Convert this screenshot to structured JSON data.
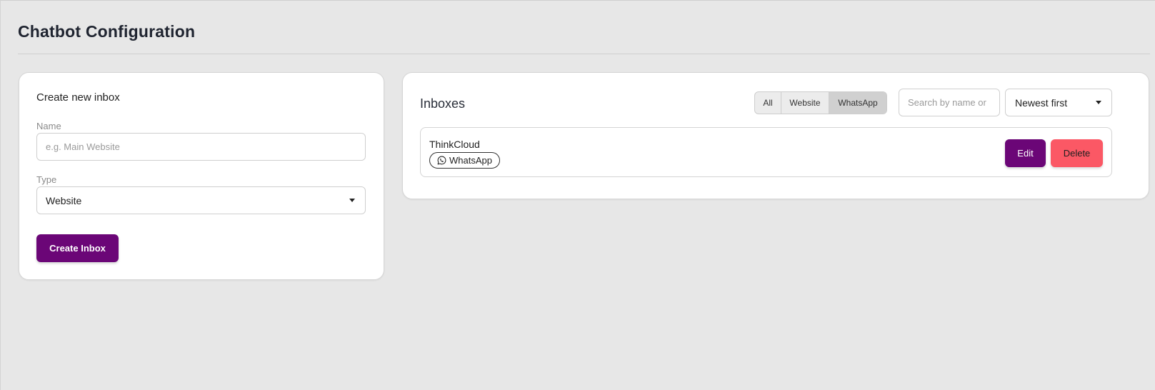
{
  "page": {
    "title": "Chatbot Configuration"
  },
  "create_card": {
    "title": "Create new inbox",
    "name_label": "Name",
    "name_placeholder": "e.g. Main Website",
    "name_value": "",
    "type_label": "Type",
    "type_value": "Website",
    "submit_label": "Create Inbox"
  },
  "inboxes_card": {
    "title": "Inboxes",
    "filters": [
      {
        "label": "All",
        "active": false
      },
      {
        "label": "Website",
        "active": false
      },
      {
        "label": "WhatsApp",
        "active": true
      }
    ],
    "search_placeholder": "Search by name or",
    "sort_value": "Newest first",
    "items": [
      {
        "name": "ThinkCloud",
        "type_badge": "WhatsApp",
        "type_icon": "whatsapp-icon",
        "edit_label": "Edit",
        "delete_label": "Delete"
      }
    ]
  },
  "colors": {
    "primary": "#6b0677",
    "danger": "#fb5865",
    "background": "#e7e7e7"
  }
}
